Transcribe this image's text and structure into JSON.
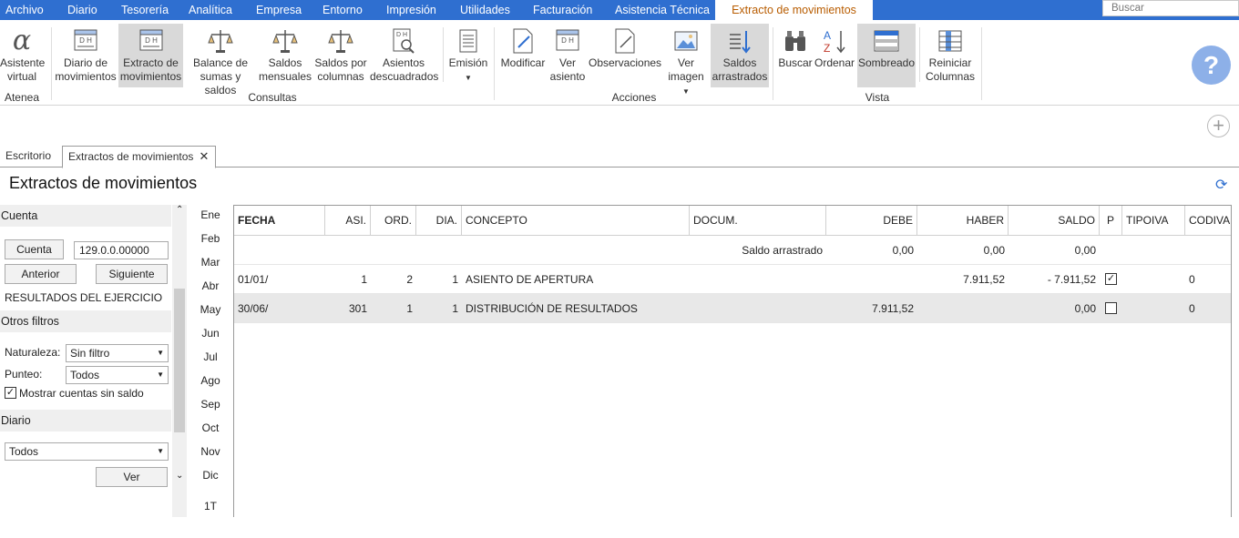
{
  "menu": {
    "items": [
      "Archivo",
      "Diario",
      "Tesorería",
      "Analítica",
      "Empresa",
      "Entorno",
      "Impresión",
      "Utilidades",
      "Facturación",
      "Asistencia Técnica"
    ],
    "active": "Extracto de movimientos",
    "search_placeholder": "Buscar"
  },
  "ribbon": {
    "atenea": {
      "btn": [
        "Asistente",
        "virtual"
      ],
      "group": "Atenea"
    },
    "consultas": {
      "group": "Consultas",
      "buttons": [
        [
          "Diario de",
          "movimientos"
        ],
        [
          "Extracto de",
          "movimientos"
        ],
        [
          "Balance de",
          "sumas y saldos"
        ],
        [
          "Saldos",
          "mensuales"
        ],
        [
          "Saldos por",
          "columnas"
        ],
        [
          "Asientos",
          "descuadrados"
        ],
        [
          "Emisión",
          ""
        ]
      ]
    },
    "acciones": {
      "group": "Acciones",
      "buttons": [
        [
          "Modificar",
          ""
        ],
        [
          "Ver",
          "asiento"
        ],
        [
          "Observaciones",
          ""
        ],
        [
          "Ver",
          "imagen"
        ],
        [
          "Saldos",
          "arrastrados"
        ]
      ]
    },
    "vista": {
      "group": "Vista",
      "buttons": [
        [
          "Buscar",
          ""
        ],
        [
          "Ordenar",
          ""
        ],
        [
          "Sombreado",
          ""
        ],
        [
          "Reiniciar",
          "Columnas"
        ]
      ]
    }
  },
  "tabs": [
    "Escritorio",
    "Extractos de movimientos"
  ],
  "page_title": "Extractos de movimientos",
  "sidebar": {
    "cuenta_header": "Cuenta",
    "cuenta_button": "Cuenta",
    "cuenta_value": "129.0.0.00000",
    "anterior": "Anterior",
    "siguiente": "Siguiente",
    "account_name": "RESULTADOS DEL EJERCICIO",
    "otros_header": "Otros filtros",
    "naturaleza_label": "Naturaleza:",
    "naturaleza_value": "Sin filtro",
    "punteo_label": "Punteo:",
    "punteo_value": "Todos",
    "mostrar_label": "Mostrar cuentas sin saldo",
    "diario_header": "Diario",
    "diario_value": "Todos",
    "ver": "Ver"
  },
  "months": [
    "Ene",
    "Feb",
    "Mar",
    "Abr",
    "May",
    "Jun",
    "Jul",
    "Ago",
    "Sep",
    "Oct",
    "Nov",
    "Dic",
    "1T"
  ],
  "grid": {
    "headers": [
      "FECHA",
      "ASI.",
      "ORD.",
      "DIA.",
      "CONCEPTO",
      "DOCUM.",
      "DEBE",
      "HABER",
      "SALDO",
      "P",
      "TIPOIVA",
      "CODIVA"
    ],
    "saldo_row": {
      "label": "Saldo arrastrado",
      "debe": "0,00",
      "haber": "0,00",
      "saldo": "0,00"
    },
    "rows": [
      {
        "fecha": "01/01/",
        "asi": "1",
        "ord": "2",
        "dia": "1",
        "concepto": "ASIENTO DE APERTURA",
        "debe": "",
        "haber": "7.911,52",
        "saldo": "- 7.911,52",
        "p": "✓",
        "codiva": "0"
      },
      {
        "fecha": "30/06/",
        "asi": "301",
        "ord": "1",
        "dia": "1",
        "concepto": "DISTRIBUCIÓN DE RESULTADOS",
        "debe": "7.911,52",
        "haber": "",
        "saldo": "0,00",
        "p": "",
        "codiva": "0"
      }
    ]
  }
}
